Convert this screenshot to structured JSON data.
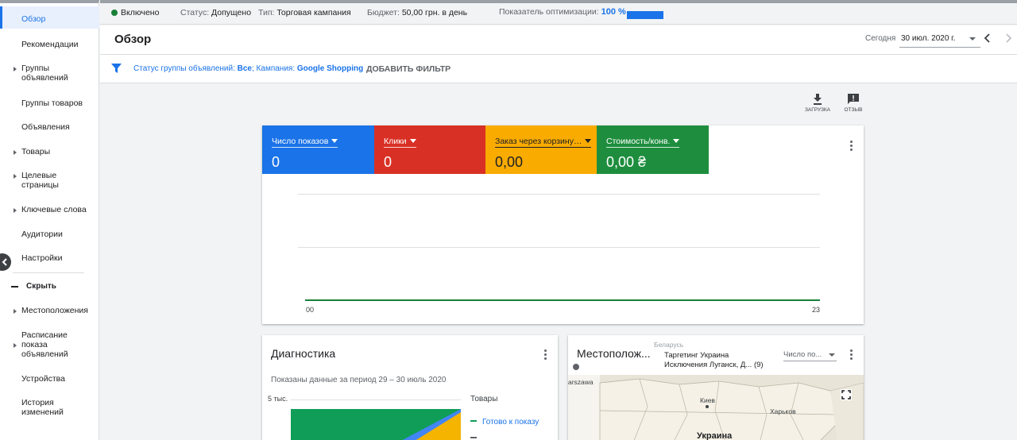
{
  "sidebar": {
    "items": [
      {
        "label": "Обзор"
      },
      {
        "label": "Рекомендации"
      },
      {
        "label": "Группы объявлений"
      },
      {
        "label": "Группы товаров"
      },
      {
        "label": "Объявления"
      },
      {
        "label": "Товары"
      },
      {
        "label": "Целевые страницы"
      },
      {
        "label": "Ключевые слова"
      },
      {
        "label": "Аудитории"
      },
      {
        "label": "Настройки"
      }
    ],
    "hide_label": "Скрыть",
    "more_items": [
      {
        "label": "Местоположения"
      },
      {
        "label": "Расписание показа объявлений"
      },
      {
        "label": "Устройства"
      },
      {
        "label": "История изменений"
      }
    ]
  },
  "status_bar": {
    "enabled": "Включено",
    "status_label": "Статус:",
    "status_value": "Допущено",
    "type_label": "Тип:",
    "type_value": "Торговая кампания",
    "budget_label": "Бюджет:",
    "budget_value": "50,00 грн. в день",
    "opt_label": "Показатель оптимизации:",
    "opt_value": "100 %",
    "opt_fraction": 1.0,
    "status_color": "#188038"
  },
  "header": {
    "title": "Обзор",
    "date_label": "Сегодня",
    "date_value": "30 июл. 2020 г."
  },
  "filter": {
    "prefix1": "Статус группы объявлений: ",
    "value1": "Все",
    "sep": "; Кампания: ",
    "value2": "Google Shopping",
    "add_filter": "ДОБАВИТЬ ФИЛЬТР"
  },
  "tools": {
    "download": "ЗАГРУЗКА",
    "feedback": "ОТЗЫВ"
  },
  "performance": {
    "metrics": [
      {
        "name": "Число показов",
        "value": "0",
        "color": "#1a73e8"
      },
      {
        "name": "Клики",
        "value": "0",
        "color": "#d93025"
      },
      {
        "name": "Заказ через корзину…",
        "value": "0,00",
        "color": "#f9ab00"
      },
      {
        "name": "Стоимость/конв.",
        "value": "0,00 ₴",
        "color": "#1e8e3e"
      }
    ],
    "chart_data": {
      "type": "line",
      "x": [
        "00",
        "23"
      ],
      "series": [
        {
          "values": [
            0,
            0
          ],
          "color": "#188038"
        }
      ],
      "grid": true
    }
  },
  "diagnostics": {
    "title": "Диагностика",
    "subtitle": "Показаны данные за период 29 – 30 июль 2020",
    "ytick": "5 тыс.",
    "legend_title": "Товары",
    "legend_item": "Готово к показу",
    "colors": {
      "ready": "#0f9d58",
      "blue": "#4285f4",
      "yellow": "#f4b400"
    }
  },
  "locations": {
    "title": "Местополож...",
    "targeting_line1": "Таргетинг Украина",
    "targeting_line2": "Исключения Луганск, Д...",
    "targeting_count": "(9)",
    "metric_select": "Число по...",
    "map_labels": {
      "belarus": "Беларусь",
      "warszawa": "arszawa",
      "kiev": "Киев",
      "kharkov": "Харьков",
      "ukraine": "Украина"
    }
  }
}
